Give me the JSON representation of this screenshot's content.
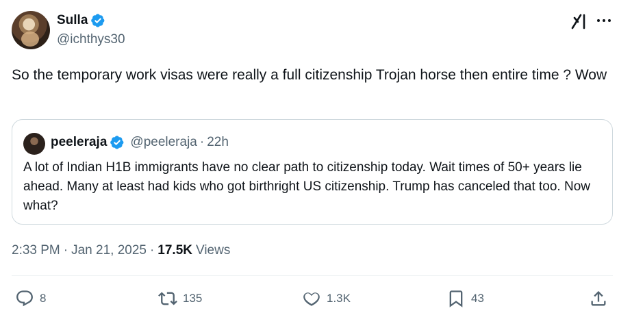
{
  "author": {
    "display_name": "Sulla",
    "handle": "@ichthys30",
    "verified": true
  },
  "tweet_text": "So the temporary work visas were really a full citizenship Trojan horse then entire time ? Wow",
  "quote": {
    "display_name": "peeleraja",
    "handle": "@peeleraja",
    "separator": "·",
    "time": "22h",
    "text": "A lot of Indian H1B immigrants have no clear path to citizenship today. Wait times of 50+ years lie ahead. Many at least had kids who got birthright US citizenship. Trump has canceled that too. Now what?"
  },
  "meta": {
    "time": "2:33 PM",
    "dot1": "·",
    "date": "Jan 21, 2025",
    "dot2": "·",
    "views_count": "17.5K",
    "views_label": "Views"
  },
  "actions": {
    "replies": "8",
    "reposts": "135",
    "likes": "1.3K",
    "bookmarks": "43"
  },
  "icons": {
    "verified": "verified-badge-icon",
    "grok": "grok-icon",
    "more": "more-icon",
    "reply": "reply-icon",
    "repost": "repost-icon",
    "like": "like-icon",
    "bookmark": "bookmark-icon",
    "share": "share-icon"
  },
  "colors": {
    "verified_blue": "#1d9bf0",
    "secondary_text": "#536471",
    "primary_text": "#0f1419",
    "border": "#cfd9de"
  }
}
